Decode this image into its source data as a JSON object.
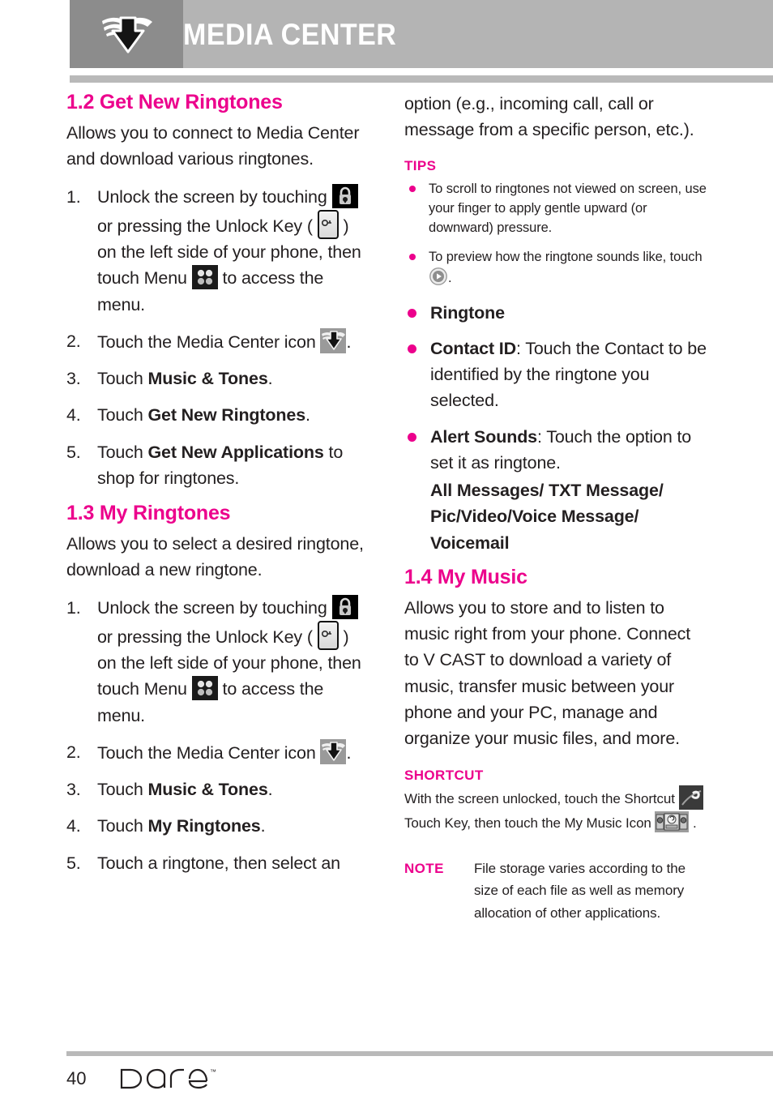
{
  "header": {
    "title": "MEDIA CENTER",
    "logo_icon": "winged-arrow-logo"
  },
  "left_column": {
    "section_1": {
      "heading": "1.2 Get New Ringtones",
      "intro": "Allows you to connect to Media Center and download various ringtones.",
      "steps": [
        {
          "num": "1.",
          "parts": [
            {
              "t": "text",
              "v": "Unlock the screen by touching "
            },
            {
              "t": "icon",
              "v": "lock-icon"
            },
            {
              "t": "text",
              "v": " or pressing the Unlock Key ( "
            },
            {
              "t": "icon",
              "v": "unlock-key-icon"
            },
            {
              "t": "text",
              "v": " ) on the left side of your phone, then touch Menu "
            },
            {
              "t": "icon",
              "v": "menu-grid-icon"
            },
            {
              "t": "text",
              "v": " to access the menu."
            }
          ]
        },
        {
          "num": "2.",
          "parts": [
            {
              "t": "text",
              "v": "Touch the Media Center icon "
            },
            {
              "t": "icon",
              "v": "media-center-icon"
            },
            {
              "t": "text",
              "v": "."
            }
          ]
        },
        {
          "num": "3.",
          "parts": [
            {
              "t": "text",
              "v": "Touch "
            },
            {
              "t": "bold",
              "v": "Music & Tones"
            },
            {
              "t": "text",
              "v": "."
            }
          ]
        },
        {
          "num": "4.",
          "parts": [
            {
              "t": "text",
              "v": "Touch "
            },
            {
              "t": "bold",
              "v": "Get New Ringtones"
            },
            {
              "t": "text",
              "v": "."
            }
          ]
        },
        {
          "num": "5.",
          "parts": [
            {
              "t": "text",
              "v": "Touch "
            },
            {
              "t": "bold",
              "v": "Get New Applications"
            },
            {
              "t": "text",
              "v": " to shop for ringtones."
            }
          ]
        }
      ]
    },
    "section_2": {
      "heading": "1.3 My Ringtones",
      "intro": "Allows you to select a desired ringtone, download a new ringtone.",
      "steps": [
        {
          "num": "1.",
          "parts": [
            {
              "t": "text",
              "v": "Unlock the screen by touching "
            },
            {
              "t": "icon",
              "v": "lock-icon"
            },
            {
              "t": "text",
              "v": " or pressing the Unlock Key ( "
            },
            {
              "t": "icon",
              "v": "unlock-key-icon"
            },
            {
              "t": "text",
              "v": " ) on the left side of your phone, then touch Menu "
            },
            {
              "t": "icon",
              "v": "menu-grid-icon"
            },
            {
              "t": "text",
              "v": " to access the menu."
            }
          ]
        },
        {
          "num": "2.",
          "parts": [
            {
              "t": "text",
              "v": "Touch the Media Center icon "
            },
            {
              "t": "icon",
              "v": "media-center-icon"
            },
            {
              "t": "text",
              "v": "."
            }
          ]
        },
        {
          "num": "3.",
          "parts": [
            {
              "t": "text",
              "v": "Touch "
            },
            {
              "t": "bold",
              "v": "Music & Tones"
            },
            {
              "t": "text",
              "v": "."
            }
          ]
        },
        {
          "num": "4.",
          "parts": [
            {
              "t": "text",
              "v": "Touch "
            },
            {
              "t": "bold",
              "v": "My Ringtones"
            },
            {
              "t": "text",
              "v": "."
            }
          ]
        },
        {
          "num": "5.",
          "parts": [
            {
              "t": "text",
              "v": "Touch a ringtone, then select an"
            }
          ]
        }
      ]
    }
  },
  "right_column": {
    "continued_text": "option (e.g., incoming call, call or message from a specific person, etc.).",
    "tips": {
      "label": "TIPS",
      "items": [
        {
          "parts": [
            {
              "t": "text",
              "v": "To scroll to ringtones not viewed on screen, use your finger to apply gentle upward (or downward) pressure."
            }
          ]
        },
        {
          "parts": [
            {
              "t": "text",
              "v": "To preview how the ringtone sounds like, touch "
            },
            {
              "t": "icon",
              "v": "play-button-icon"
            },
            {
              "t": "text",
              "v": "."
            }
          ]
        }
      ]
    },
    "options": [
      {
        "parts": [
          {
            "t": "bold",
            "v": "Ringtone"
          }
        ]
      },
      {
        "parts": [
          {
            "t": "bold",
            "v": "Contact ID"
          },
          {
            "t": "text",
            "v": ": Touch the Contact to be identified by the ringtone you selected."
          }
        ]
      },
      {
        "parts": [
          {
            "t": "bold",
            "v": "Alert Sounds"
          },
          {
            "t": "text",
            "v": ": Touch the option to set it as ringtone."
          },
          {
            "t": "subbold",
            "v": "All Messages/ TXT Message/ Pic/Video/Voice Message/ Voicemail"
          }
        ]
      }
    ],
    "section_3": {
      "heading": "1.4 My Music",
      "intro": "Allows you to store and to listen to music right from your phone. Connect to V CAST to download a variety of music, transfer music between your phone and your PC, manage and organize your music files, and more."
    },
    "shortcut": {
      "label": "SHORTCUT",
      "parts": [
        {
          "t": "text",
          "v": "With the screen unlocked, touch the Shortcut "
        },
        {
          "t": "icon",
          "v": "shortcut-touch-key-icon"
        },
        {
          "t": "text",
          "v": " Touch Key, then touch the My Music Icon "
        },
        {
          "t": "icon",
          "v": "my-music-icon"
        },
        {
          "t": "text",
          "v": " ."
        }
      ]
    },
    "note": {
      "label": "NOTE",
      "text": "File storage varies according to the size of each file as well as memory allocation of other applications."
    }
  },
  "footer": {
    "page_number": "40",
    "brand": "Dare",
    "trademark": "™"
  },
  "colors": {
    "accent_pink": "#ec008c",
    "header_bar": "#b4b4b4",
    "header_logo_box": "#8c8c8c",
    "rule": "#b9b9b9",
    "body_text": "#231f20"
  }
}
